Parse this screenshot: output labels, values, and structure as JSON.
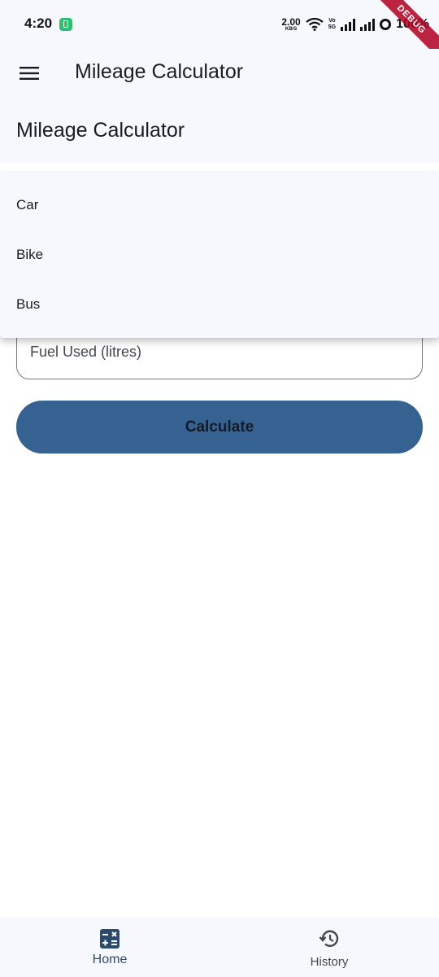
{
  "status_bar": {
    "time": "4:20",
    "net_speed": "2.00",
    "net_unit": "KB/S",
    "volte_top": "Vo",
    "volte_bottom": "5G",
    "battery": "100%",
    "debug_label": "DEBUG"
  },
  "app_bar": {
    "title": "Mileage Calculator",
    "menu_icon": "menu-icon"
  },
  "page": {
    "heading": "Mileage Calculator"
  },
  "dropdown": {
    "options": [
      {
        "label": "Car"
      },
      {
        "label": "Bike"
      },
      {
        "label": "Bus"
      }
    ]
  },
  "form": {
    "fuel_placeholder": "Fuel Used (litres)",
    "calculate_label": "Calculate"
  },
  "bottom_nav": {
    "items": [
      {
        "label": "Home",
        "icon": "calculator-icon",
        "selected": true
      },
      {
        "label": "History",
        "icon": "history-icon",
        "selected": false
      }
    ]
  },
  "colors": {
    "primary": "#366291",
    "surface": "#f7f8fd",
    "debug": "#b00020"
  }
}
